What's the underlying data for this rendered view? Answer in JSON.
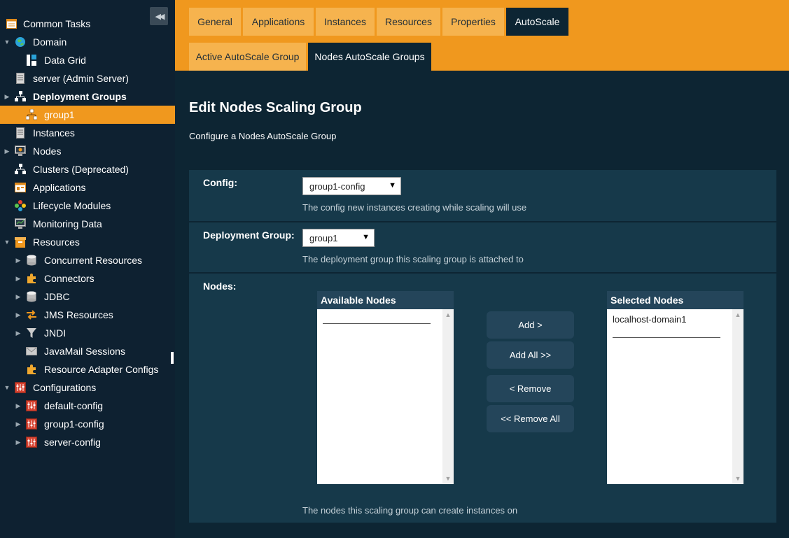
{
  "sidebar": {
    "items": [
      {
        "label": "Common Tasks"
      },
      {
        "label": "Domain"
      },
      {
        "label": "Data Grid"
      },
      {
        "label": "server (Admin Server)"
      },
      {
        "label": "Deployment Groups"
      },
      {
        "label": "group1"
      },
      {
        "label": "Instances"
      },
      {
        "label": "Nodes"
      },
      {
        "label": "Clusters (Deprecated)"
      },
      {
        "label": "Applications"
      },
      {
        "label": "Lifecycle Modules"
      },
      {
        "label": "Monitoring Data"
      },
      {
        "label": "Resources"
      },
      {
        "label": "Concurrent Resources"
      },
      {
        "label": "Connectors"
      },
      {
        "label": "JDBC"
      },
      {
        "label": "JMS Resources"
      },
      {
        "label": "JNDI"
      },
      {
        "label": "JavaMail Sessions"
      },
      {
        "label": "Resource Adapter Configs"
      },
      {
        "label": "Configurations"
      },
      {
        "label": "default-config"
      },
      {
        "label": "group1-config"
      },
      {
        "label": "server-config"
      }
    ]
  },
  "tabs": {
    "primary": [
      "General",
      "Applications",
      "Instances",
      "Resources",
      "Properties",
      "AutoScale"
    ],
    "secondary": [
      "Active AutoScale Group",
      "Nodes AutoScale Groups"
    ]
  },
  "page": {
    "title": "Edit Nodes Scaling Group",
    "description": "Configure a Nodes AutoScale Group"
  },
  "form": {
    "config": {
      "label": "Config:",
      "value": "group1-config",
      "help": "The config new instances creating while scaling will use"
    },
    "deployment_group": {
      "label": "Deployment Group:",
      "value": "group1",
      "help": "The deployment group this scaling group is attached to"
    },
    "nodes": {
      "label": "Nodes:",
      "available_header": "Available Nodes",
      "selected_header": "Selected Nodes",
      "selected_items": [
        "localhost-domain1"
      ],
      "buttons": {
        "add": "Add >",
        "add_all": "Add All >>",
        "remove": "< Remove",
        "remove_all": "<< Remove All"
      },
      "help": "The nodes this scaling group can create instances on"
    }
  },
  "colors": {
    "accent": "#f0981e",
    "sidebar_bg": "#0e2131",
    "content_bg": "#0d2533",
    "section_bg": "#16394a",
    "panel_header": "#24455a"
  },
  "icons": {
    "collapse": "double-chevron-left-icon",
    "expand": "triangle-right-icon",
    "collapse_tree": "triangle-down-icon"
  }
}
